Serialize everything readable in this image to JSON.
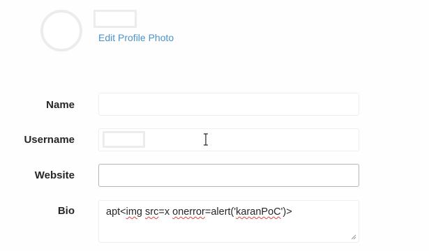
{
  "profile": {
    "edit_photo_label": "Edit Profile Photo"
  },
  "form": {
    "name": {
      "label": "Name",
      "value": ""
    },
    "username": {
      "label": "Username",
      "value": ""
    },
    "website": {
      "label": "Website",
      "value": ""
    },
    "bio": {
      "label": "Bio",
      "value_parts": [
        "apt<",
        "img",
        " ",
        "src",
        "=x ",
        "onerror",
        "=alert('",
        "karanPoC",
        "')>"
      ]
    }
  },
  "colors": {
    "link": "#4a93c9",
    "label": "#262626",
    "field_border": "#efefef",
    "field_border_focus": "#b4b4b4",
    "spellcheck": "#e04040"
  },
  "icons": {
    "avatar": "avatar-placeholder-icon",
    "text_cursor": "i-beam-cursor-icon",
    "resize": "resize-grip-icon"
  }
}
